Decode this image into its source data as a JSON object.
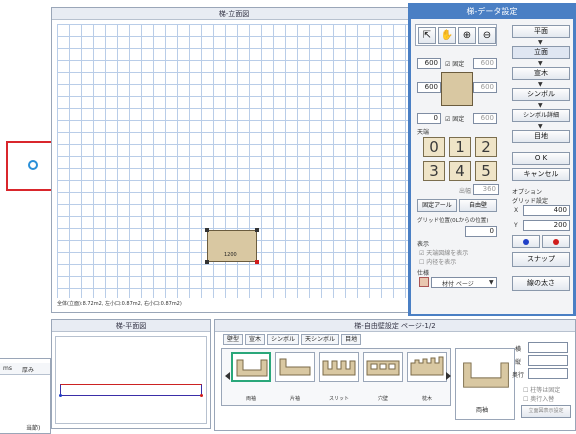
{
  "elevation": {
    "title": "梯-立面図",
    "status": "全体(立面):8.72m2, 左小口:0.87m2, 右小口:0.87m2)",
    "panel_label": "1200"
  },
  "plan": {
    "title": "梯-平面図"
  },
  "leftstub": {
    "label1": "ms",
    "label2": "厚み",
    "label3": "当節)"
  },
  "wallset": {
    "title": "梯-自由壁設定 ページ-1/2",
    "tabs": [
      "壁型",
      "宣木",
      "シンボル",
      "天シンボル",
      "目地"
    ],
    "tiles": [
      "両袖",
      "片袖",
      "スリット",
      "穴壁",
      "枕木",
      "両袖"
    ],
    "fields": {
      "width_label": "横",
      "height_label": "縦",
      "depth_label": "奥行"
    },
    "checks": [
      "柱等は固定",
      "奥行入替"
    ],
    "apply": "立面図表示設定"
  },
  "props": {
    "title": "梯-データ設定",
    "dim_top": "600",
    "dim_top_right": "600",
    "dim_mid": "600",
    "dim_mid_right": "600",
    "dim_bot": "0",
    "dim_bot_right": "600",
    "fixed": "固定",
    "label_height": "天端",
    "digits": [
      "0",
      "1",
      "2",
      "3",
      "4",
      "5"
    ],
    "label_width": "出幅",
    "width_val": "360",
    "fixed_all": "固定アール",
    "free_wall": "自由壁",
    "grid_pos": "グリッド位置(0Lからの位置)",
    "grid_val": "0",
    "display": "表示",
    "display_opts": [
      "天端図線を表示",
      "内径を表示"
    ],
    "joint": "仕様",
    "joint_sel": "材付 ページ",
    "nav": [
      "平面",
      "立面",
      "宣木",
      "シンボル",
      "シンボル詳細",
      "目地"
    ],
    "ok": "O K",
    "cancel": "キャンセル",
    "option": "オプション",
    "grid_setting": "グリッド設定",
    "x_label": "X",
    "x_val": "400",
    "y_label": "Y",
    "y_val": "200",
    "snap": "スナップ",
    "line_width": "線の太さ"
  },
  "colors": {
    "accent": "#4a7fc4",
    "highlight": "#d9262c",
    "panel": "#d9c8a2",
    "dot_blue": "#1f3fc8",
    "dot_red": "#d01c1c"
  }
}
